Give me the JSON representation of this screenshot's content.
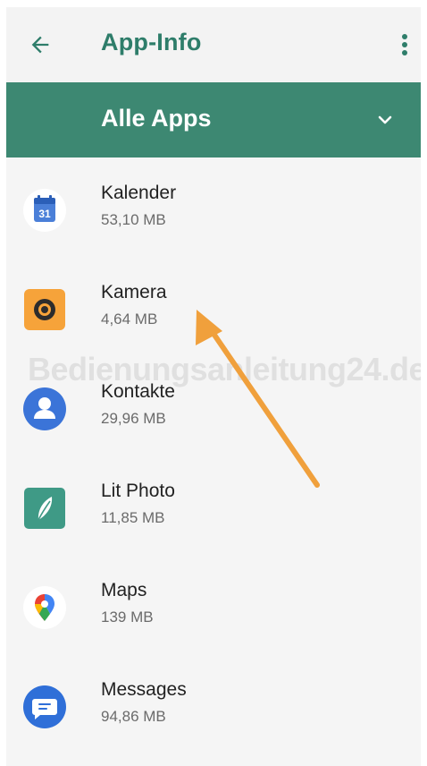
{
  "appbar": {
    "title": "App-Info",
    "back_icon": "arrow-left-icon",
    "more_icon": "more-vert-icon",
    "accent_color": "#2e7d6a"
  },
  "filter": {
    "label": "Alle Apps",
    "chevron_icon": "chevron-down-icon",
    "background_color": "#3d8872"
  },
  "apps": [
    {
      "name": "Kalender",
      "size": "53,10 MB",
      "icon": "calendar-icon",
      "icon_text": "31"
    },
    {
      "name": "Kamera",
      "size": "4,64 MB",
      "icon": "camera-icon"
    },
    {
      "name": "Kontakte",
      "size": "29,96 MB",
      "icon": "contacts-icon"
    },
    {
      "name": "Lit Photo",
      "size": "11,85 MB",
      "icon": "lit-photo-icon"
    },
    {
      "name": "Maps",
      "size": "139 MB",
      "icon": "maps-icon"
    },
    {
      "name": "Messages",
      "size": "94,86 MB",
      "icon": "messages-icon"
    }
  ],
  "watermark": "Bedienungsanleitung24.de",
  "annotation": {
    "arrow_color": "#f0a03c",
    "points_to": "Kamera"
  }
}
